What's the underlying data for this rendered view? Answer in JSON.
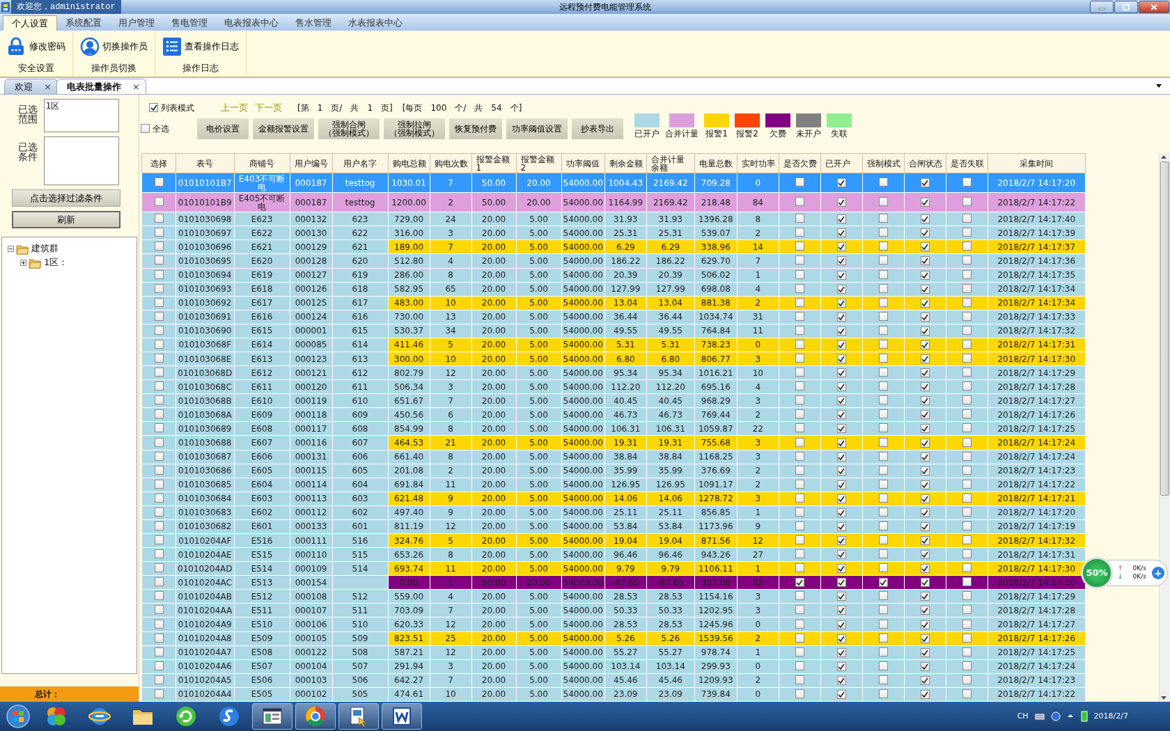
{
  "titlebar": {
    "welcome": "欢迎您，administrator",
    "title": "远程预付费电能管理系统"
  },
  "menu": [
    {
      "label": "个人设置",
      "selected": true
    },
    {
      "label": "系统配置",
      "selected": false
    },
    {
      "label": "用户管理",
      "selected": false
    },
    {
      "label": "售电管理",
      "selected": false
    },
    {
      "label": "电表报表中心",
      "selected": false
    },
    {
      "label": "售水管理",
      "selected": false
    },
    {
      "label": "水表报表中心",
      "selected": false
    }
  ],
  "ribbon": [
    {
      "label": "安全设置",
      "buttons": [
        {
          "label": "修改密码",
          "kind": "lock"
        }
      ]
    },
    {
      "label": "操作员切换",
      "buttons": [
        {
          "label": "切换操作员",
          "kind": "user"
        }
      ]
    },
    {
      "label": "操作日志",
      "buttons": [
        {
          "label": "查看操作日志",
          "kind": "list"
        }
      ]
    }
  ],
  "doc_tabs": [
    {
      "label": "欢迎",
      "close": "×",
      "selected": false
    },
    {
      "label": "电表批量操作",
      "close": "×",
      "selected": true
    }
  ],
  "filter": {
    "range_label": "已选范围",
    "range_value": "1区",
    "cond_label": "已选条件",
    "filter_button": "点击选择过滤条件",
    "refresh_button": "刷新"
  },
  "tree": [
    {
      "label": "建筑群",
      "expanded": true,
      "children": [
        {
          "label": "1区：",
          "expanded": false
        }
      ]
    }
  ],
  "total_label": "总计：",
  "toolbar": {
    "list_mode": {
      "label": "列表模式",
      "checked": true
    },
    "prev": "上一页",
    "next": "下一页",
    "pager": [
      "[第",
      "1",
      "页/",
      "共",
      "1",
      "页]",
      "[每页",
      "100",
      "个/",
      "共",
      "54",
      "个]"
    ],
    "select_all": {
      "label": "全选",
      "checked": false
    },
    "buttons": [
      {
        "label": "电价设置"
      },
      {
        "label": "金额报警设置"
      },
      {
        "label": "强制合闸",
        "sub": "（强制模式）"
      },
      {
        "label": "强制拉闸",
        "sub": "（强制模式）"
      },
      {
        "label": "恢复预付费"
      },
      {
        "label": "功率阈值设置"
      },
      {
        "label": "抄表导出"
      }
    ]
  },
  "legend": [
    {
      "label": "已开户",
      "kind": "open",
      "color": "#add8e6"
    },
    {
      "label": "合并计量",
      "kind": "merged",
      "color": "#dda0dd"
    },
    {
      "label": "报警1",
      "kind": "alarm1",
      "color": "#ffd700"
    },
    {
      "label": "报警2",
      "kind": "alarm2",
      "color": "#ff4500"
    },
    {
      "label": "欠费",
      "kind": "arrears",
      "color": "#800080"
    },
    {
      "label": "未开户",
      "kind": "closed",
      "color": "#808080"
    },
    {
      "label": "失联",
      "kind": "lost",
      "color": "#90ee90"
    }
  ],
  "table": {
    "columns": [
      {
        "label": "选择",
        "kind": "check"
      },
      {
        "label": "表号",
        "kind": "text"
      },
      {
        "label": "商铺号",
        "kind": "text"
      },
      {
        "label": "用户编号",
        "kind": "text"
      },
      {
        "label": "用户名字",
        "kind": "text"
      },
      {
        "label": "购电总额",
        "kind": "text"
      },
      {
        "label": "购电次数",
        "kind": "text"
      },
      {
        "label": "报警金额1",
        "kind": "text"
      },
      {
        "label": "报警金额2",
        "kind": "text"
      },
      {
        "label": "功率阈值",
        "kind": "text"
      },
      {
        "label": "剩余金额",
        "kind": "text"
      },
      {
        "label": "合并计量余额",
        "kind": "text"
      },
      {
        "label": "电量总数",
        "kind": "text"
      },
      {
        "label": "实时功率",
        "kind": "text"
      },
      {
        "label": "是否欠费",
        "kind": "check"
      },
      {
        "label": "已开户",
        "kind": "check"
      },
      {
        "label": "强制模式",
        "kind": "check"
      },
      {
        "label": "合闸状态",
        "kind": "check"
      },
      {
        "label": "是否失联",
        "kind": "check"
      },
      {
        "label": "采集时间",
        "kind": "text"
      }
    ],
    "rows": [
      {
        "selected": true,
        "kind": "open",
        "cells": [
          false,
          "01010101B7",
          "E403不可断电",
          "000187",
          "testtog",
          "1030.01",
          "7",
          "50.00",
          "20.00",
          "54000.00",
          "1004.43",
          "2169.42",
          "709.28",
          "0",
          false,
          true,
          false,
          true,
          false,
          "2018/2/7 14:17:20"
        ]
      },
      {
        "selected": false,
        "kind": "merged",
        "cells": [
          false,
          "01010101B9",
          "E405不可断电",
          "000187",
          "testtog",
          "1200.00",
          "2",
          "50.00",
          "20.00",
          "54000.00",
          "1164.99",
          "2169.42",
          "218.48",
          "84",
          false,
          true,
          false,
          true,
          false,
          "2018/2/7 14:17:22"
        ]
      },
      {
        "selected": false,
        "kind": "open",
        "cells": [
          false,
          "0101030698",
          "E623",
          "000132",
          "623",
          "729.00",
          "24",
          "20.00",
          "5.00",
          "54000.00",
          "31.93",
          "31.93",
          "1396.28",
          "8",
          false,
          true,
          false,
          true,
          false,
          "2018/2/7 14:17:40"
        ]
      },
      {
        "selected": false,
        "kind": "open",
        "cells": [
          false,
          "0101030697",
          "E622",
          "000130",
          "622",
          "316.00",
          "3",
          "20.00",
          "5.00",
          "54000.00",
          "25.31",
          "25.31",
          "539.07",
          "2",
          false,
          true,
          false,
          true,
          false,
          "2018/2/7 14:17:39"
        ]
      },
      {
        "selected": false,
        "kind": "alarm1",
        "cells": [
          false,
          "0101030696",
          "E621",
          "000129",
          "621",
          "189.00",
          "7",
          "20.00",
          "5.00",
          "54000.00",
          "6.29",
          "6.29",
          "338.96",
          "14",
          false,
          true,
          false,
          true,
          false,
          "2018/2/7 14:17:37"
        ]
      },
      {
        "selected": false,
        "kind": "open",
        "cells": [
          false,
          "0101030695",
          "E620",
          "000128",
          "620",
          "512.80",
          "4",
          "20.00",
          "5.00",
          "54000.00",
          "186.22",
          "186.22",
          "629.70",
          "7",
          false,
          true,
          false,
          true,
          false,
          "2018/2/7 14:17:36"
        ]
      },
      {
        "selected": false,
        "kind": "open",
        "cells": [
          false,
          "0101030694",
          "E619",
          "000127",
          "619",
          "286.00",
          "8",
          "20.00",
          "5.00",
          "54000.00",
          "20.39",
          "20.39",
          "506.02",
          "1",
          false,
          true,
          false,
          true,
          false,
          "2018/2/7 14:17:35"
        ]
      },
      {
        "selected": false,
        "kind": "open",
        "cells": [
          false,
          "0101030693",
          "E618",
          "000126",
          "618",
          "582.95",
          "65",
          "20.00",
          "5.00",
          "54000.00",
          "127.99",
          "127.99",
          "698.08",
          "4",
          false,
          true,
          false,
          true,
          false,
          "2018/2/7 14:17:34"
        ]
      },
      {
        "selected": false,
        "kind": "alarm1",
        "cells": [
          false,
          "0101030692",
          "E617",
          "000125",
          "617",
          "483.00",
          "10",
          "20.00",
          "5.00",
          "54000.00",
          "13.04",
          "13.04",
          "881.38",
          "2",
          false,
          true,
          false,
          true,
          false,
          "2018/2/7 14:17:34"
        ]
      },
      {
        "selected": false,
        "kind": "open",
        "cells": [
          false,
          "0101030691",
          "E616",
          "000124",
          "616",
          "730.00",
          "13",
          "20.00",
          "5.00",
          "54000.00",
          "36.44",
          "36.44",
          "1034.74",
          "31",
          false,
          true,
          false,
          true,
          false,
          "2018/2/7 14:17:33"
        ]
      },
      {
        "selected": false,
        "kind": "open",
        "cells": [
          false,
          "0101030690",
          "E615",
          "000001",
          "615",
          "530.37",
          "34",
          "20.00",
          "5.00",
          "54000.00",
          "49.55",
          "49.55",
          "764.84",
          "11",
          false,
          true,
          false,
          true,
          false,
          "2018/2/7 14:17:32"
        ]
      },
      {
        "selected": false,
        "kind": "alarm1",
        "cells": [
          false,
          "010103068F",
          "E614",
          "000085",
          "614",
          "411.46",
          "5",
          "20.00",
          "5.00",
          "54000.00",
          "5.31",
          "5.31",
          "738.23",
          "0",
          false,
          true,
          false,
          true,
          false,
          "2018/2/7 14:17:31"
        ]
      },
      {
        "selected": false,
        "kind": "alarm1",
        "cells": [
          false,
          "010103068E",
          "E613",
          "000123",
          "613",
          "300.00",
          "10",
          "20.00",
          "5.00",
          "54000.00",
          "6.80",
          "6.80",
          "806.77",
          "3",
          false,
          true,
          false,
          true,
          false,
          "2018/2/7 14:17:30"
        ]
      },
      {
        "selected": false,
        "kind": "open",
        "cells": [
          false,
          "010103068D",
          "E612",
          "000121",
          "612",
          "802.79",
          "12",
          "20.00",
          "5.00",
          "54000.00",
          "95.34",
          "95.34",
          "1016.21",
          "10",
          false,
          true,
          false,
          true,
          false,
          "2018/2/7 14:17:29"
        ]
      },
      {
        "selected": false,
        "kind": "open",
        "cells": [
          false,
          "010103068C",
          "E611",
          "000120",
          "611",
          "506.34",
          "3",
          "20.00",
          "5.00",
          "54000.00",
          "112.20",
          "112.20",
          "695.16",
          "4",
          false,
          true,
          false,
          true,
          false,
          "2018/2/7 14:17:28"
        ]
      },
      {
        "selected": false,
        "kind": "open",
        "cells": [
          false,
          "010103068B",
          "E610",
          "000119",
          "610",
          "651.67",
          "7",
          "20.00",
          "5.00",
          "54000.00",
          "40.45",
          "40.45",
          "968.29",
          "3",
          false,
          true,
          false,
          true,
          false,
          "2018/2/7 14:17:27"
        ]
      },
      {
        "selected": false,
        "kind": "open",
        "cells": [
          false,
          "010103068A",
          "E609",
          "000118",
          "609",
          "450.56",
          "6",
          "20.00",
          "5.00",
          "54000.00",
          "46.73",
          "46.73",
          "769.44",
          "2",
          false,
          true,
          false,
          true,
          false,
          "2018/2/7 14:17:26"
        ]
      },
      {
        "selected": false,
        "kind": "open",
        "cells": [
          false,
          "0101030689",
          "E608",
          "000117",
          "608",
          "854.99",
          "8",
          "20.00",
          "5.00",
          "54000.00",
          "106.31",
          "106.31",
          "1059.87",
          "22",
          false,
          true,
          false,
          true,
          false,
          "2018/2/7 14:17:25"
        ]
      },
      {
        "selected": false,
        "kind": "alarm1",
        "cells": [
          false,
          "0101030688",
          "E607",
          "000116",
          "607",
          "464.53",
          "21",
          "20.00",
          "5.00",
          "54000.00",
          "19.31",
          "19.31",
          "755.68",
          "3",
          false,
          true,
          false,
          true,
          false,
          "2018/2/7 14:17:24"
        ]
      },
      {
        "selected": false,
        "kind": "open",
        "cells": [
          false,
          "0101030687",
          "E606",
          "000131",
          "606",
          "661.40",
          "8",
          "20.00",
          "5.00",
          "54000.00",
          "38.84",
          "38.84",
          "1168.25",
          "3",
          false,
          true,
          false,
          true,
          false,
          "2018/2/7 14:17:24"
        ]
      },
      {
        "selected": false,
        "kind": "open",
        "cells": [
          false,
          "0101030686",
          "E605",
          "000115",
          "605",
          "201.08",
          "2",
          "20.00",
          "5.00",
          "54000.00",
          "35.99",
          "35.99",
          "376.69",
          "2",
          false,
          true,
          false,
          true,
          false,
          "2018/2/7 14:17:23"
        ]
      },
      {
        "selected": false,
        "kind": "open",
        "cells": [
          false,
          "0101030685",
          "E604",
          "000114",
          "604",
          "691.84",
          "11",
          "20.00",
          "5.00",
          "54000.00",
          "126.95",
          "126.95",
          "1091.17",
          "2",
          false,
          true,
          false,
          true,
          false,
          "2018/2/7 14:17:22"
        ]
      },
      {
        "selected": false,
        "kind": "alarm1",
        "cells": [
          false,
          "0101030684",
          "E603",
          "000113",
          "603",
          "621.48",
          "9",
          "20.00",
          "5.00",
          "54000.00",
          "14.06",
          "14.06",
          "1278.72",
          "3",
          false,
          true,
          false,
          true,
          false,
          "2018/2/7 14:17:21"
        ]
      },
      {
        "selected": false,
        "kind": "open",
        "cells": [
          false,
          "0101030683",
          "E602",
          "000112",
          "602",
          "497.40",
          "9",
          "20.00",
          "5.00",
          "54000.00",
          "25.11",
          "25.11",
          "856.85",
          "1",
          false,
          true,
          false,
          true,
          false,
          "2018/2/7 14:17:20"
        ]
      },
      {
        "selected": false,
        "kind": "open",
        "cells": [
          false,
          "0101030682",
          "E601",
          "000133",
          "601",
          "811.19",
          "12",
          "20.00",
          "5.00",
          "54000.00",
          "53.84",
          "53.84",
          "1173.96",
          "9",
          false,
          true,
          false,
          true,
          false,
          "2018/2/7 14:17:19"
        ]
      },
      {
        "selected": false,
        "kind": "alarm1",
        "cells": [
          false,
          "01010204AF",
          "E516",
          "000111",
          "516",
          "324.76",
          "5",
          "20.00",
          "5.00",
          "54000.00",
          "19.04",
          "19.04",
          "871.56",
          "12",
          false,
          true,
          false,
          true,
          false,
          "2018/2/7 14:17:32"
        ]
      },
      {
        "selected": false,
        "kind": "open",
        "cells": [
          false,
          "01010204AE",
          "E515",
          "000110",
          "515",
          "653.26",
          "8",
          "20.00",
          "5.00",
          "54000.00",
          "96.46",
          "96.46",
          "943.26",
          "27",
          false,
          true,
          false,
          true,
          false,
          "2018/2/7 14:17:31"
        ]
      },
      {
        "selected": false,
        "kind": "alarm1",
        "cells": [
          false,
          "01010204AD",
          "E514",
          "000109",
          "514",
          "693.74",
          "11",
          "20.00",
          "5.00",
          "54000.00",
          "9.79",
          "9.79",
          "1106.11",
          "1",
          false,
          true,
          false,
          true,
          false,
          "2018/2/7 14:17:30"
        ]
      },
      {
        "selected": false,
        "kind": "arrears",
        "cells": [
          false,
          "01010204AC",
          "E513",
          "000154",
          null,
          "0.00",
          "1",
          "50.00",
          "20.00",
          "54000.00",
          "-87.65",
          "-87.65",
          "307.08",
          "92",
          true,
          true,
          true,
          true,
          false,
          "2018/2/7 14:17:30"
        ]
      },
      {
        "selected": false,
        "kind": "open",
        "cells": [
          false,
          "01010204AB",
          "E512",
          "000108",
          "512",
          "559.00",
          "4",
          "20.00",
          "5.00",
          "54000.00",
          "28.53",
          "28.53",
          "1154.16",
          "3",
          false,
          true,
          false,
          true,
          false,
          "2018/2/7 14:17:29"
        ]
      },
      {
        "selected": false,
        "kind": "open",
        "cells": [
          false,
          "01010204AA",
          "E511",
          "000107",
          "511",
          "703.09",
          "7",
          "20.00",
          "5.00",
          "54000.00",
          "50.33",
          "50.33",
          "1202.95",
          "3",
          false,
          true,
          false,
          true,
          false,
          "2018/2/7 14:17:28"
        ]
      },
      {
        "selected": false,
        "kind": "open",
        "cells": [
          false,
          "01010204A9",
          "E510",
          "000106",
          "510",
          "620.33",
          "12",
          "20.00",
          "5.00",
          "54000.00",
          "28.53",
          "28.53",
          "1245.96",
          "0",
          false,
          true,
          false,
          true,
          false,
          "2018/2/7 14:17:27"
        ]
      },
      {
        "selected": false,
        "kind": "alarm1",
        "cells": [
          false,
          "01010204A8",
          "E509",
          "000105",
          "509",
          "823.51",
          "25",
          "20.00",
          "5.00",
          "54000.00",
          "5.26",
          "5.26",
          "1539.56",
          "2",
          false,
          true,
          false,
          true,
          false,
          "2018/2/7 14:17:26"
        ]
      },
      {
        "selected": false,
        "kind": "open",
        "cells": [
          false,
          "01010204A7",
          "E508",
          "000122",
          "508",
          "587.21",
          "12",
          "20.00",
          "5.00",
          "54000.00",
          "55.27",
          "55.27",
          "978.74",
          "1",
          false,
          true,
          false,
          true,
          false,
          "2018/2/7 14:17:25"
        ]
      },
      {
        "selected": false,
        "kind": "open",
        "cells": [
          false,
          "01010204A6",
          "E507",
          "000104",
          "507",
          "291.94",
          "3",
          "20.00",
          "5.00",
          "54000.00",
          "103.14",
          "103.14",
          "299.93",
          "0",
          false,
          true,
          false,
          true,
          false,
          "2018/2/7 14:17:24"
        ]
      },
      {
        "selected": false,
        "kind": "open",
        "cells": [
          false,
          "01010204A5",
          "E506",
          "000103",
          "506",
          "642.27",
          "7",
          "20.00",
          "5.00",
          "54000.00",
          "45.46",
          "45.46",
          "1209.93",
          "2",
          false,
          true,
          false,
          true,
          false,
          "2018/2/7 14:17:23"
        ]
      },
      {
        "selected": false,
        "kind": "open",
        "cells": [
          false,
          "01010204A4",
          "E505",
          "000102",
          "505",
          "474.61",
          "10",
          "20.00",
          "5.00",
          "54000.00",
          "23.09",
          "23.09",
          "739.84",
          "0",
          false,
          true,
          false,
          true,
          false,
          "2018/2/7 14:17:22"
        ]
      }
    ]
  },
  "widget": {
    "percent": "50%",
    "up_arrow": "↑",
    "up": "0K/s",
    "down_arrow": "↓",
    "down": "0K/s",
    "plus": "+"
  },
  "taskbar": {
    "apps": [
      {
        "kind": "pinwheel",
        "selected": false
      },
      {
        "kind": "globe",
        "selected": false
      },
      {
        "kind": "folder",
        "selected": false
      },
      {
        "kind": "refresh",
        "selected": false
      },
      {
        "kind": "swirl",
        "selected": false
      },
      {
        "kind": "window",
        "selected": true
      },
      {
        "kind": "wheel",
        "selected": true
      },
      {
        "kind": "document",
        "selected": true
      },
      {
        "kind": "word",
        "selected": true
      }
    ],
    "lang": "CH",
    "date": "2018/2/7"
  }
}
